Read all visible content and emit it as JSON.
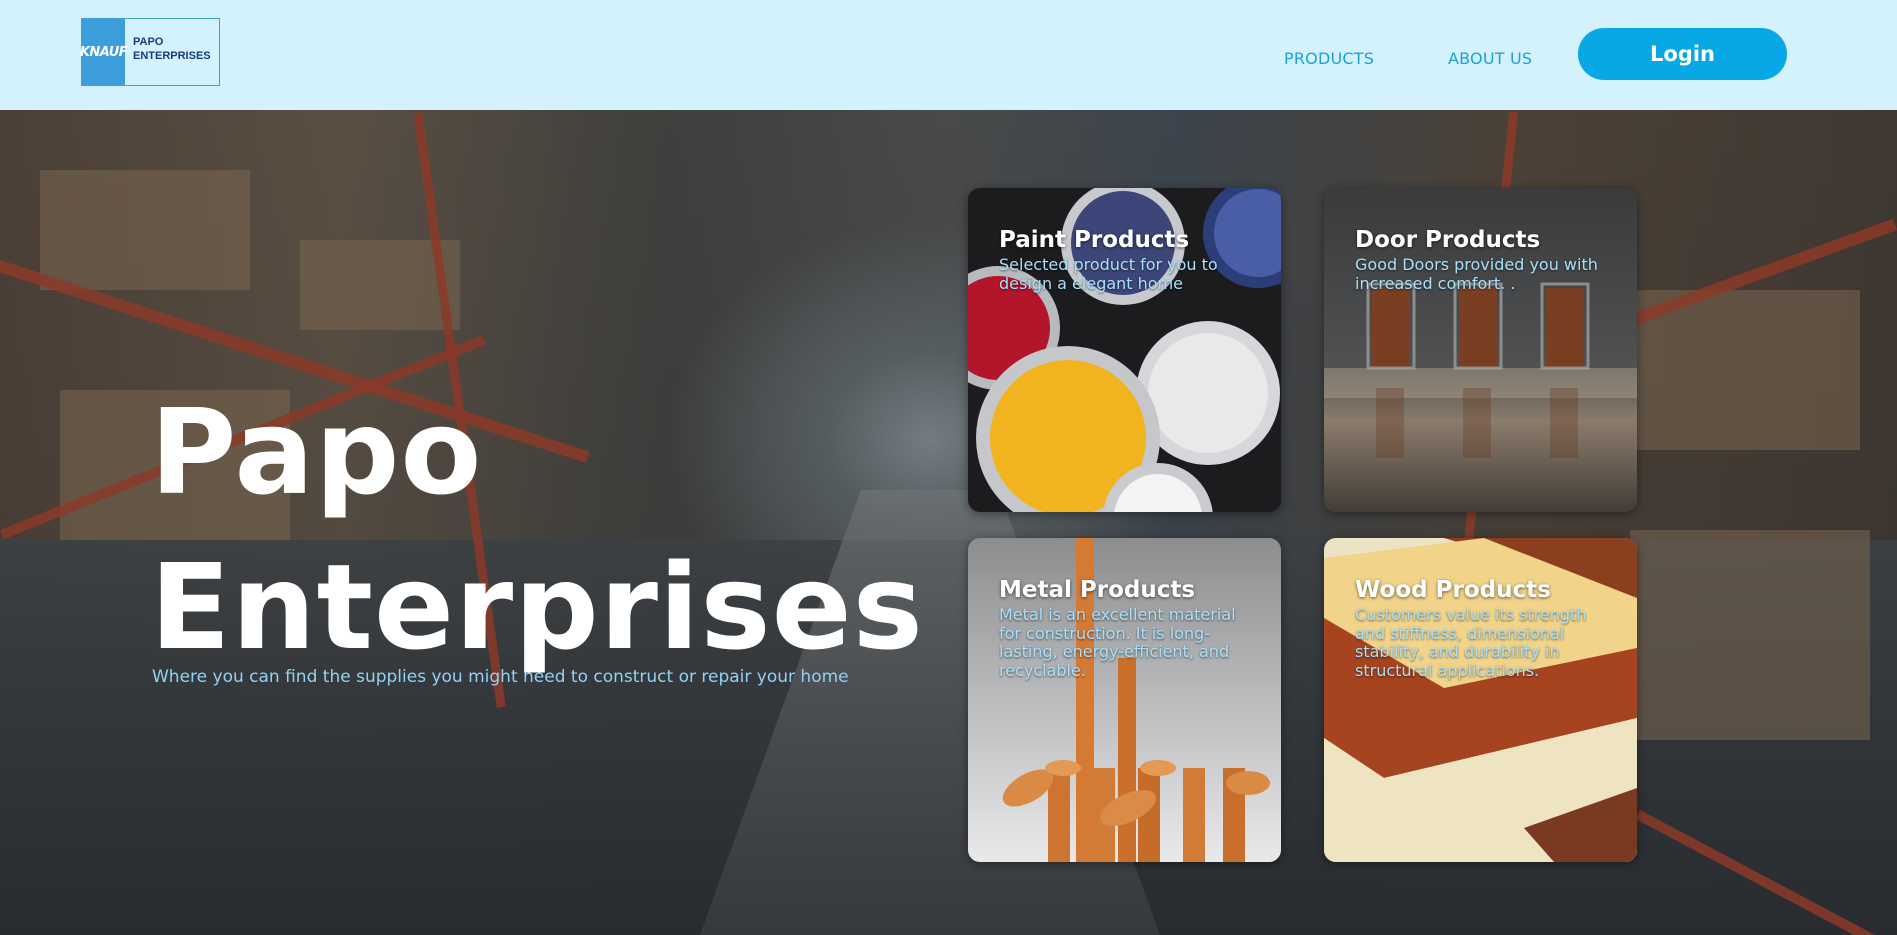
{
  "header": {
    "logo_mark": "KNAUF",
    "logo_line1": "PAPO",
    "logo_line2": "ENTERPRISES",
    "nav": [
      {
        "label": "PRODUCTS"
      },
      {
        "label": "ABOUT US"
      }
    ],
    "login_label": "Login"
  },
  "hero": {
    "title_line1": "Papo",
    "title_line2": "Enterprises",
    "subtitle": "Where you can find the supplies you might need to construct or repair your home"
  },
  "cards": [
    {
      "title": "Paint Products",
      "description": "Selected product for you to design a elegant home"
    },
    {
      "title": "Door Products",
      "description": "Good Doors provided you with increased comfort. ."
    },
    {
      "title": "Metal Products",
      "description": "Metal is an excellent material for construction. It is long-lasting, energy-efficient, and recyclable."
    },
    {
      "title": "Wood Products",
      "description": "Customers value its strength and stiffness, dimensional stability, and durability in structural applications."
    }
  ],
  "colors": {
    "header_bg": "#d4f2fd",
    "accent": "#08a7e5",
    "nav_text": "#1aa3d9",
    "subtitle_text": "#8ed3f4"
  }
}
